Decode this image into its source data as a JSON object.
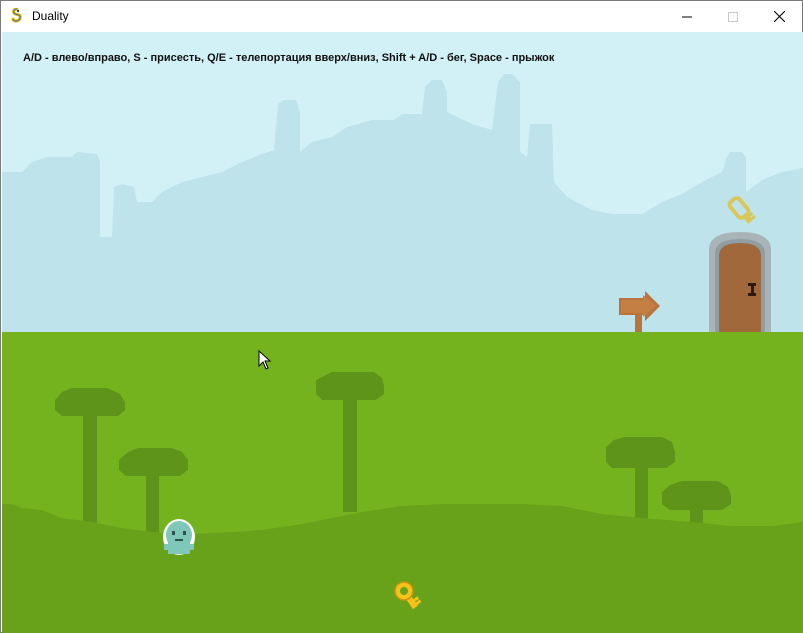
{
  "window": {
    "title": "Duality",
    "controls": [
      "minimize",
      "maximize",
      "close"
    ]
  },
  "hud": {
    "controls_hint": "A/D - влево/вправо, S - присесть, Q/E - телепортация вверх/вниз, Shift + A/D - бег, Space - прыжок"
  },
  "colors": {
    "sky": "#d2f1f7",
    "city_silhouette": "#bfe3eb",
    "grass": "#75b31e",
    "grass_dark": "#68a21b",
    "tree": "#5e9419",
    "door_frame": "#a8b4b8",
    "door": "#a0683b",
    "sign": "#b8743c",
    "key_gold": "#f4c21a",
    "key_pale": "#d8c85a",
    "player": "#7fc7b8"
  },
  "icons": [
    "pygame-snake-icon",
    "minimize-icon",
    "maximize-icon",
    "close-icon",
    "mouse-cursor-icon",
    "key-icon",
    "door-icon",
    "arrow-sign-icon"
  ]
}
